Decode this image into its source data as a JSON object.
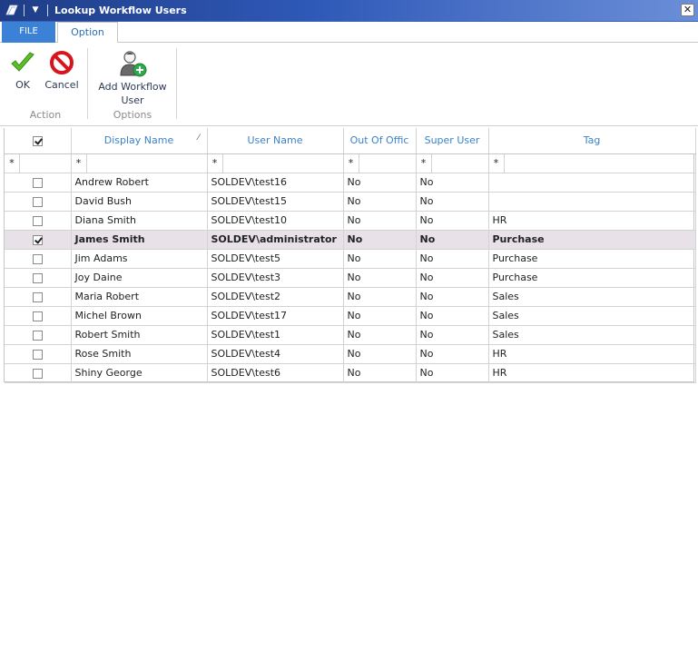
{
  "window": {
    "title": "Lookup Workflow Users",
    "close_glyph": "✕"
  },
  "tabs": {
    "file": "FILE",
    "option": "Option"
  },
  "ribbon": {
    "ok_label": "OK",
    "cancel_label": "Cancel",
    "action_group": "Action",
    "add_user_label_1": "Add Workflow",
    "add_user_label_2": "User",
    "options_group": "Options"
  },
  "grid": {
    "columns": {
      "display_name": "Display Name",
      "user_name": "User Name",
      "out_of_office": "Out Of Offic",
      "super_user": "Super User",
      "tag": "Tag"
    },
    "filter_glyph": "*",
    "rows": [
      {
        "checked": false,
        "display_name": "Andrew Robert",
        "user_name": "SOLDEV\\test16",
        "out_of_office": "No",
        "super_user": "No",
        "tag": ""
      },
      {
        "checked": false,
        "display_name": "David Bush",
        "user_name": "SOLDEV\\test15",
        "out_of_office": "No",
        "super_user": "No",
        "tag": ""
      },
      {
        "checked": false,
        "display_name": "Diana Smith",
        "user_name": "SOLDEV\\test10",
        "out_of_office": "No",
        "super_user": "No",
        "tag": "HR"
      },
      {
        "checked": true,
        "display_name": "James Smith",
        "user_name": "SOLDEV\\administrator",
        "out_of_office": "No",
        "super_user": "No",
        "tag": "Purchase"
      },
      {
        "checked": false,
        "display_name": "Jim Adams",
        "user_name": "SOLDEV\\test5",
        "out_of_office": "No",
        "super_user": "No",
        "tag": "Purchase"
      },
      {
        "checked": false,
        "display_name": "Joy Daine",
        "user_name": "SOLDEV\\test3",
        "out_of_office": "No",
        "super_user": "No",
        "tag": "Purchase"
      },
      {
        "checked": false,
        "display_name": "Maria Robert",
        "user_name": "SOLDEV\\test2",
        "out_of_office": "No",
        "super_user": "No",
        "tag": "Sales"
      },
      {
        "checked": false,
        "display_name": "Michel Brown",
        "user_name": "SOLDEV\\test17",
        "out_of_office": "No",
        "super_user": "No",
        "tag": "Sales"
      },
      {
        "checked": false,
        "display_name": "Robert Smith",
        "user_name": "SOLDEV\\test1",
        "out_of_office": "No",
        "super_user": "No",
        "tag": "Sales"
      },
      {
        "checked": false,
        "display_name": "Rose Smith",
        "user_name": "SOLDEV\\test4",
        "out_of_office": "No",
        "super_user": "No",
        "tag": "HR"
      },
      {
        "checked": false,
        "display_name": "Shiny George",
        "user_name": "SOLDEV\\test6",
        "out_of_office": "No",
        "super_user": "No",
        "tag": "HR"
      }
    ]
  }
}
